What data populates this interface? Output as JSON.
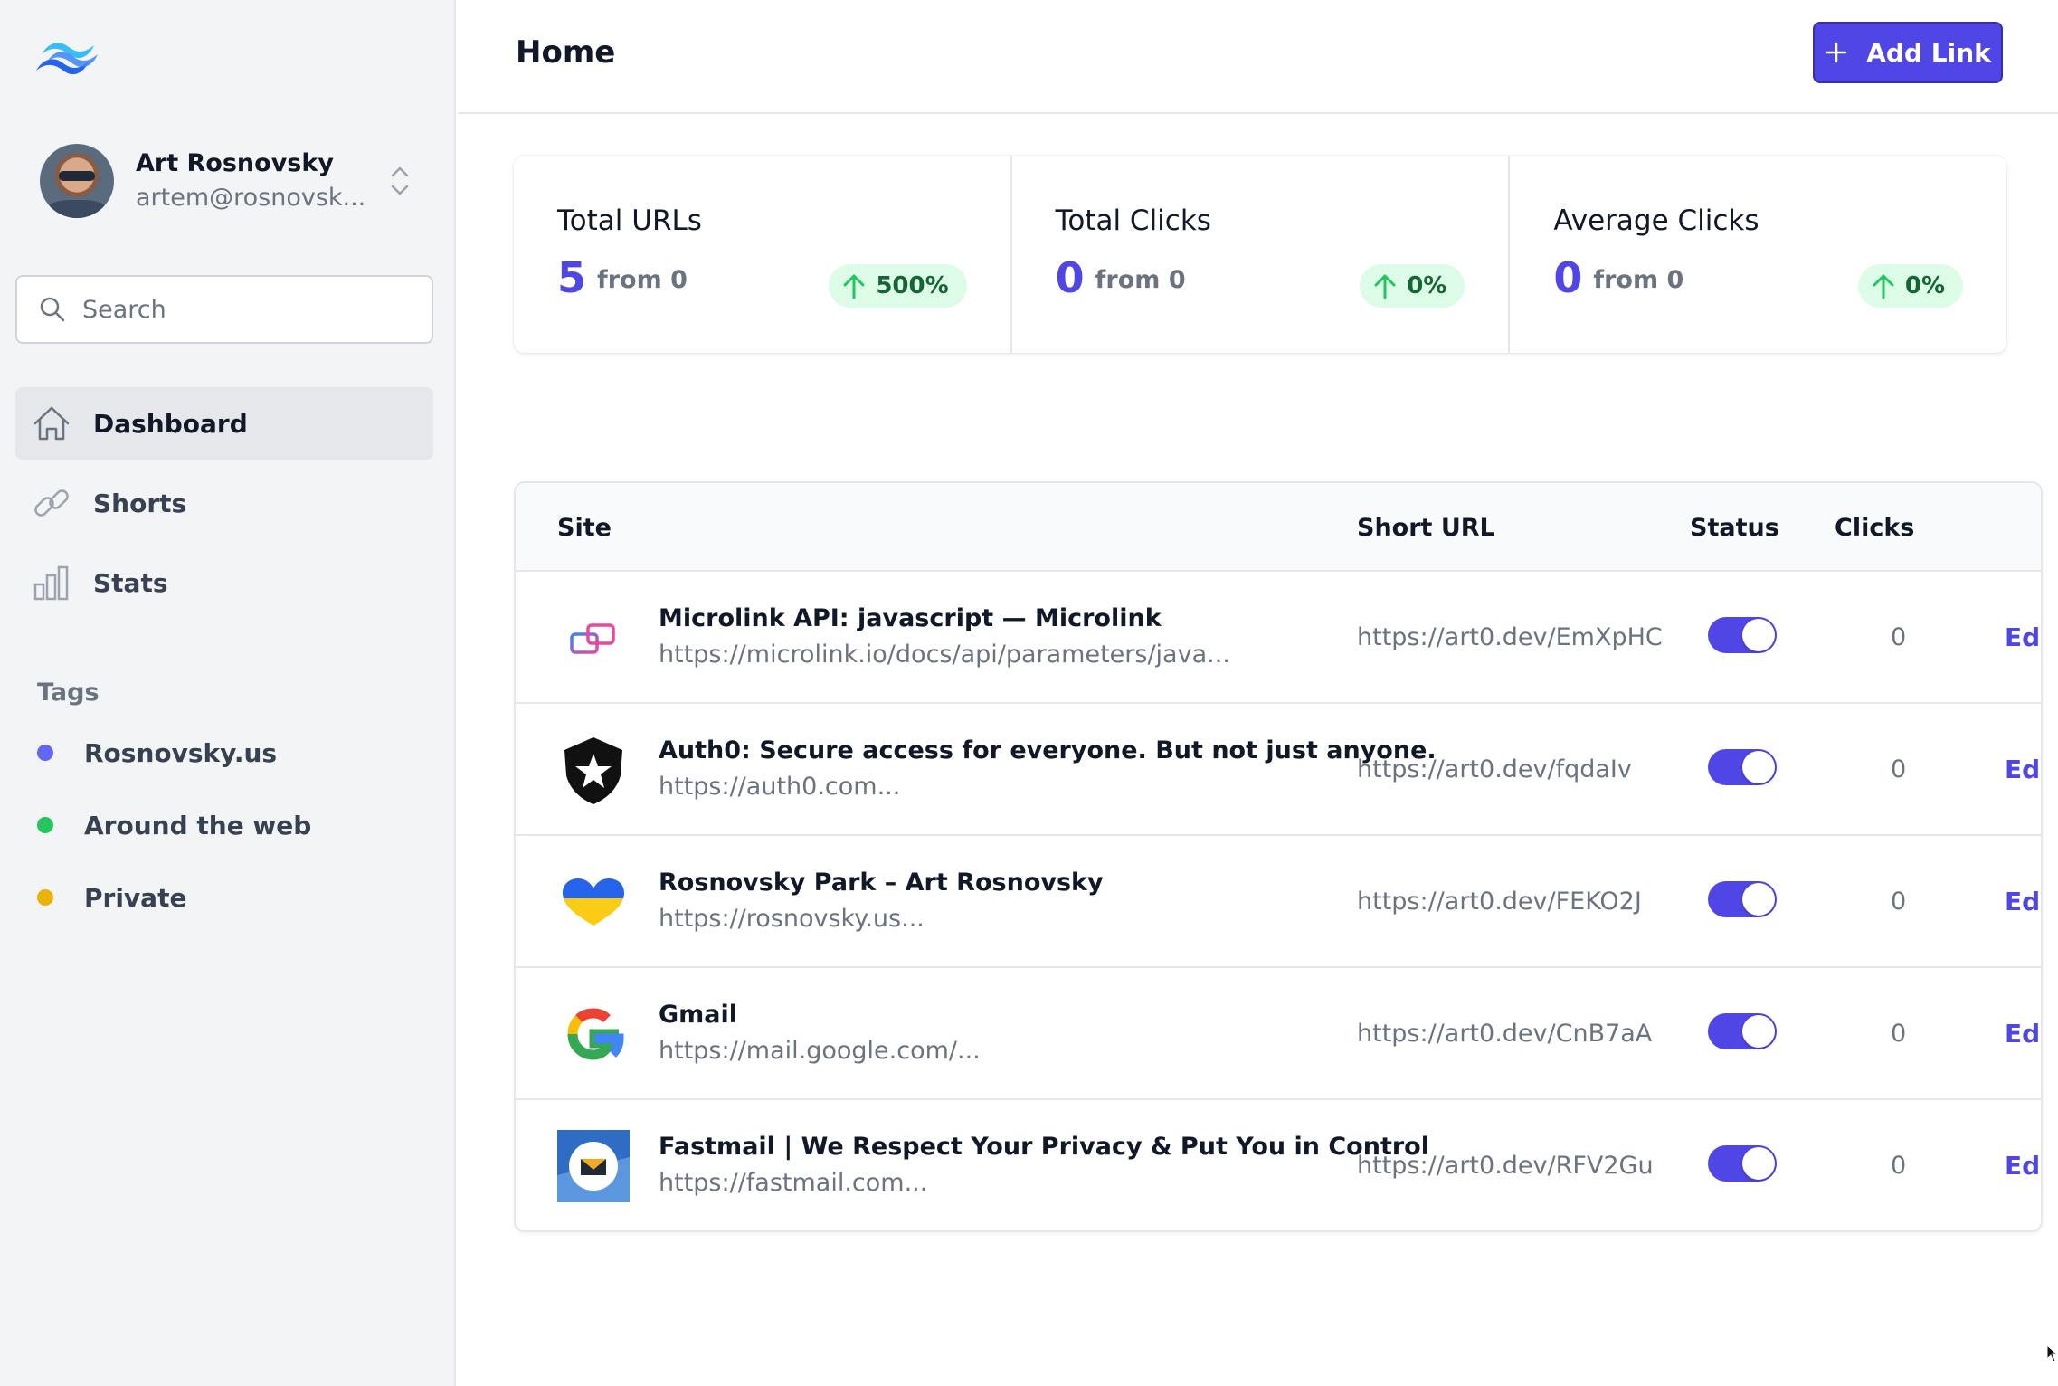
{
  "sidebar": {
    "user": {
      "name": "Art Rosnovsky",
      "email": "artem@rosnovsk..."
    },
    "search": {
      "placeholder": "Search"
    },
    "nav": [
      {
        "label": "Dashboard",
        "icon": "home-icon",
        "active": true
      },
      {
        "label": "Shorts",
        "icon": "link-icon",
        "active": false
      },
      {
        "label": "Stats",
        "icon": "bar-chart-icon",
        "active": false
      }
    ],
    "tags_title": "Tags",
    "tags": [
      {
        "label": "Rosnovsky.us",
        "color": "#6366f1"
      },
      {
        "label": "Around the web",
        "color": "#22c55e"
      },
      {
        "label": "Private",
        "color": "#eab308"
      }
    ]
  },
  "header": {
    "title": "Home",
    "add_button": "Add Link"
  },
  "stats": [
    {
      "label": "Total URLs",
      "value": "5",
      "from": "from 0",
      "change": "500%"
    },
    {
      "label": "Total Clicks",
      "value": "0",
      "from": "from 0",
      "change": "0%"
    },
    {
      "label": "Average Clicks",
      "value": "0",
      "from": "from 0",
      "change": "0%"
    }
  ],
  "table": {
    "headers": {
      "site": "Site",
      "short_url": "Short URL",
      "status": "Status",
      "clicks": "Clicks"
    },
    "rows": [
      {
        "title": "Microlink API: javascript — Microlink",
        "url": "https://microlink.io/docs/api/parameters/java...",
        "short": "https://art0.dev/EmXpHC",
        "enabled": true,
        "clicks": "0",
        "edit": "Edit",
        "icon": "microlink-logo-icon"
      },
      {
        "title": "Auth0: Secure access for everyone. But not just anyone.",
        "url": "https://auth0.com...",
        "short": "https://art0.dev/fqdaIv",
        "enabled": true,
        "clicks": "0",
        "edit": "Edit",
        "icon": "auth0-logo-icon"
      },
      {
        "title": "Rosnovsky Park – Art Rosnovsky",
        "url": "https://rosnovsky.us...",
        "short": "https://art0.dev/FEKO2J",
        "enabled": true,
        "clicks": "0",
        "edit": "Edit",
        "icon": "ukraine-heart-icon"
      },
      {
        "title": "Gmail",
        "url": "https://mail.google.com/...",
        "short": "https://art0.dev/CnB7aA",
        "enabled": true,
        "clicks": "0",
        "edit": "Edit",
        "icon": "google-logo-icon"
      },
      {
        "title": "Fastmail | We Respect Your Privacy & Put You in Control",
        "url": "https://fastmail.com...",
        "short": "https://art0.dev/RFV2Gu",
        "enabled": true,
        "clicks": "0",
        "edit": "Edit",
        "icon": "fastmail-logo-icon"
      }
    ]
  }
}
